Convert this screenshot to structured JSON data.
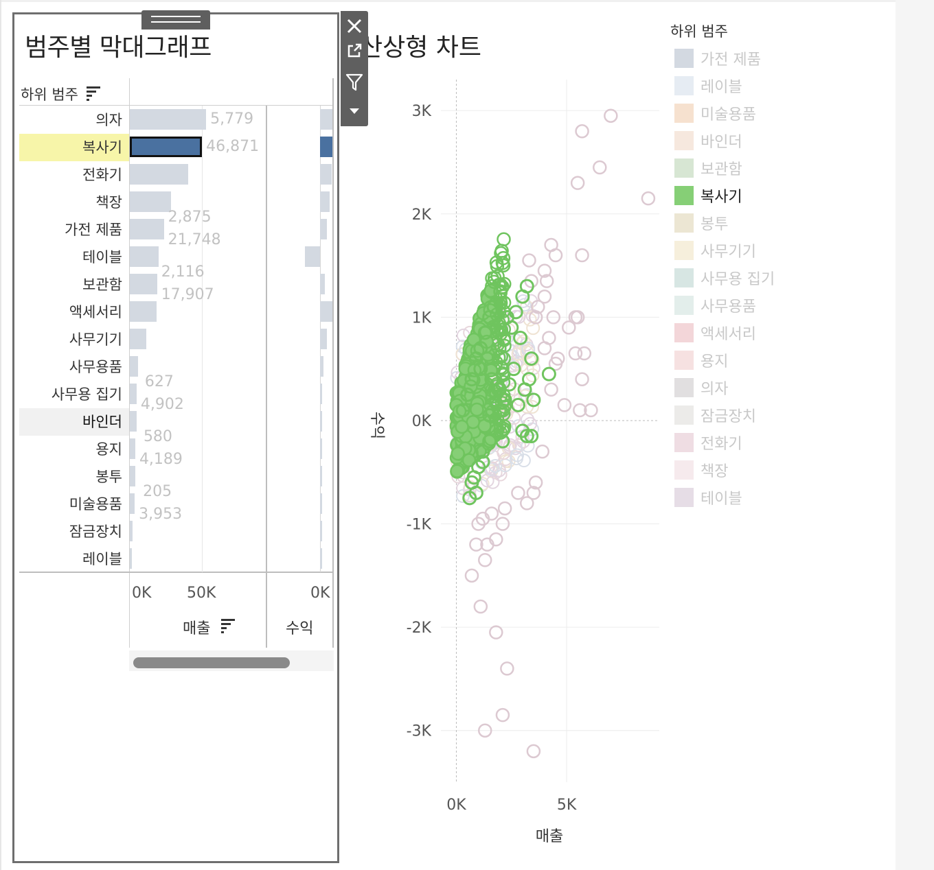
{
  "bar_sheet": {
    "title": "범주별 막대그래프",
    "row_header": "하위 범주",
    "sales_axis_title": "매출",
    "profit_axis_title": "수익",
    "sales_ticks": [
      "0K",
      "50K"
    ],
    "profit_ticks": [
      "0K"
    ]
  },
  "scatter_sheet": {
    "title_visible": "산상형 차트",
    "y_axis_title": "수익",
    "x_axis_title": "매출",
    "y_ticks": [
      "3K",
      "2K",
      "1K",
      "0K",
      "-1K",
      "-2K",
      "-3K"
    ],
    "x_ticks": [
      "0K",
      "5K"
    ]
  },
  "legend": {
    "title": "하위 범주",
    "items": [
      {
        "label": "가전 제품",
        "color": "#d3d9e1",
        "active": false
      },
      {
        "label": "레이블",
        "color": "#e6ecf3",
        "active": false
      },
      {
        "label": "미술용품",
        "color": "#f6e1cf",
        "active": false
      },
      {
        "label": "바인더",
        "color": "#f6e8de",
        "active": false
      },
      {
        "label": "보관함",
        "color": "#d7e6d3",
        "active": false
      },
      {
        "label": "복사기",
        "color": "#86cf76",
        "active": true
      },
      {
        "label": "봉투",
        "color": "#ece6d3",
        "active": false
      },
      {
        "label": "사무기기",
        "color": "#f6efdc",
        "active": false
      },
      {
        "label": "사무용 집기",
        "color": "#d7e6e3",
        "active": false
      },
      {
        "label": "사무용품",
        "color": "#e3eeeb",
        "active": false
      },
      {
        "label": "액세서리",
        "color": "#f3d6d9",
        "active": false
      },
      {
        "label": "용지",
        "color": "#f6e1e1",
        "active": false
      },
      {
        "label": "의자",
        "color": "#e1dfe0",
        "active": false
      },
      {
        "label": "잠금장치",
        "color": "#ecebe9",
        "active": false
      },
      {
        "label": "전화기",
        "color": "#efdde3",
        "active": false
      },
      {
        "label": "책장",
        "color": "#f6eaed",
        "active": false
      },
      {
        "label": "테이블",
        "color": "#e6dde6",
        "active": false
      }
    ]
  },
  "chart_data": [
    {
      "type": "bar",
      "xlabel": "매출",
      "categories": [
        "의자",
        "복사기",
        "전화기",
        "책장",
        "가전 제품",
        "테이블",
        "보관함",
        "액세서리",
        "사무기기",
        "사무용품",
        "사무용 집기",
        "바인더",
        "용지",
        "봉투",
        "미술용품",
        "잠금장치",
        "레이블"
      ],
      "values": [
        56000,
        53000,
        43000,
        30000,
        25000,
        21000,
        20000,
        19500,
        12000,
        6000,
        5000,
        5000,
        4000,
        3800,
        3600,
        1800,
        1600
      ],
      "xlim": [
        0,
        108000
      ],
      "selected": "복사기",
      "highlighted_row": "바인더",
      "data_labels": [
        {
          "category": "의자",
          "lines": [
            "5,779"
          ]
        },
        {
          "category": "복사기",
          "lines": [
            "46,871"
          ]
        },
        {
          "category": "가전 제품",
          "lines": [
            "2,875",
            "21,748"
          ]
        },
        {
          "category": "보관함",
          "lines": [
            "2,116",
            "17,907"
          ]
        },
        {
          "category": "사무용 집기",
          "lines": [
            "627",
            "4,902"
          ]
        },
        {
          "category": "용지",
          "lines": [
            "580",
            "4,189"
          ]
        },
        {
          "category": "미술용품",
          "lines": [
            "205",
            "3,953"
          ]
        }
      ]
    },
    {
      "type": "bar",
      "xlabel": "수익",
      "categories": [
        "의자",
        "복사기",
        "전화기",
        "책장",
        "가전 제품",
        "테이블",
        "보관함",
        "액세서리",
        "사무기기",
        "사무용품",
        "사무용 집기",
        "바인더",
        "용지",
        "봉투",
        "미술용품",
        "잠금장치",
        "레이블"
      ],
      "values": [
        5779,
        46871,
        5200,
        4100,
        2875,
        -5000,
        2116,
        5300,
        3100,
        1400,
        627,
        900,
        580,
        420,
        205,
        280,
        180
      ],
      "xlim": [
        -2000,
        2000
      ]
    },
    {
      "type": "scatter",
      "xlabel": "매출",
      "ylabel": "수익",
      "xlim": [
        -700,
        9200
      ],
      "ylim": [
        -3500,
        3300
      ],
      "highlight_series": "복사기",
      "series": [
        {
          "name": "복사기",
          "color": "#86cf76",
          "points": [
            [
              300,
              100
            ],
            [
              500,
              250
            ],
            [
              700,
              400
            ],
            [
              900,
              600
            ],
            [
              1100,
              700
            ],
            [
              1300,
              850
            ],
            [
              1500,
              1000
            ],
            [
              1700,
              1100
            ],
            [
              2000,
              1250
            ],
            [
              2300,
              1000
            ],
            [
              2500,
              900
            ],
            [
              2700,
              1050
            ],
            [
              3000,
              1200
            ],
            [
              3200,
              1300
            ],
            [
              3400,
              600
            ],
            [
              3300,
              400
            ],
            [
              3100,
              300
            ],
            [
              3500,
              200
            ],
            [
              4200,
              450
            ],
            [
              2100,
              -200
            ],
            [
              1800,
              -100
            ],
            [
              1500,
              50
            ],
            [
              1200,
              -300
            ],
            [
              1000,
              -450
            ],
            [
              800,
              -550
            ],
            [
              700,
              -600
            ],
            [
              600,
              -750
            ],
            [
              900,
              -700
            ],
            [
              1200,
              -400
            ],
            [
              1500,
              -200
            ],
            [
              2200,
              200
            ],
            [
              2600,
              500
            ],
            [
              2900,
              800
            ],
            [
              1900,
              300
            ],
            [
              1600,
              400
            ],
            [
              1400,
              600
            ],
            [
              1100,
              500
            ],
            [
              2400,
              350
            ],
            [
              2800,
              150
            ],
            [
              3000,
              -100
            ],
            [
              3200,
              -150
            ],
            [
              3400,
              -150
            ]
          ]
        },
        {
          "name": "기타",
          "color": "#d9cfd7",
          "points": [
            [
              5700,
              2800
            ],
            [
              7000,
              2950
            ],
            [
              6500,
              2450
            ],
            [
              5500,
              2300
            ],
            [
              8700,
              2150
            ],
            [
              5700,
              1600
            ],
            [
              4300,
              1700
            ],
            [
              4500,
              1600
            ],
            [
              3300,
              1550
            ],
            [
              4000,
              1450
            ],
            [
              3400,
              1350
            ],
            [
              4100,
              1350
            ],
            [
              4000,
              1200
            ],
            [
              3700,
              1100
            ],
            [
              3600,
              1000
            ],
            [
              4400,
              1000
            ],
            [
              5400,
              1000
            ],
            [
              5500,
              1000
            ],
            [
              5100,
              900
            ],
            [
              4200,
              800
            ],
            [
              4000,
              700
            ],
            [
              5400,
              650
            ],
            [
              5800,
              650
            ],
            [
              4500,
              550
            ],
            [
              4600,
              600
            ],
            [
              5700,
              400
            ],
            [
              4300,
              300
            ],
            [
              4900,
              150
            ],
            [
              5600,
              100
            ],
            [
              6100,
              100
            ],
            [
              3900,
              -300
            ],
            [
              3600,
              -600
            ],
            [
              3500,
              -700
            ],
            [
              3200,
              -800
            ],
            [
              2800,
              -700
            ],
            [
              2200,
              -850
            ],
            [
              1600,
              -900
            ],
            [
              1200,
              -950
            ],
            [
              1000,
              -1000
            ],
            [
              2100,
              -1000
            ],
            [
              1800,
              -1150
            ],
            [
              1400,
              -1200
            ],
            [
              900,
              -1200
            ],
            [
              1300,
              -1350
            ],
            [
              700,
              -1500
            ],
            [
              1100,
              -1800
            ],
            [
              1800,
              -2050
            ],
            [
              2300,
              -2400
            ],
            [
              2100,
              -2850
            ],
            [
              1300,
              -3000
            ],
            [
              3500,
              -3200
            ]
          ]
        }
      ]
    }
  ]
}
